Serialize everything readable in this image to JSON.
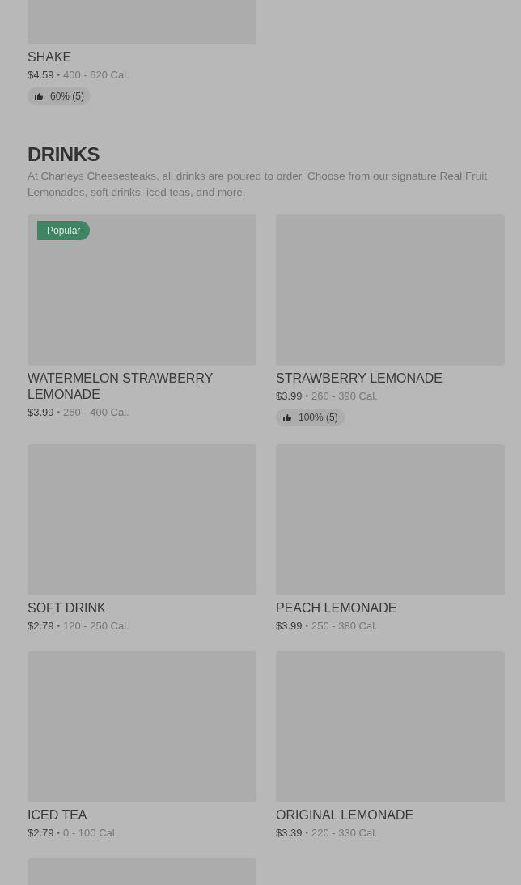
{
  "top_item": {
    "title": "SHAKE",
    "price": "$4.59",
    "separator": "•",
    "calories": "400 - 620 Cal.",
    "rating": "60% (5)"
  },
  "section": {
    "title": "DRINKS",
    "description": "At Charleys Cheesesteaks, all drinks are poured to order. Choose from our signature Real Fruit Lemonades, soft drinks, iced teas, and more.",
    "items": [
      {
        "title": "WATERMELON STRAWBERRY LEMONADE",
        "price": "$3.99",
        "separator": "•",
        "calories": "260 - 400 Cal.",
        "badge": "Popular"
      },
      {
        "title": "STRAWBERRY LEMONADE",
        "price": "$3.99",
        "separator": "•",
        "calories": "260 - 390 Cal.",
        "rating": "100% (5)"
      },
      {
        "title": "SOFT DRINK",
        "price": "$2.79",
        "separator": "•",
        "calories": "120 - 250 Cal."
      },
      {
        "title": "PEACH LEMONADE",
        "price": "$3.99",
        "separator": "•",
        "calories": "250 - 380 Cal."
      },
      {
        "title": "ICED TEA",
        "price": "$2.79",
        "separator": "•",
        "calories": "0 - 100 Cal."
      },
      {
        "title": "ORIGINAL LEMONADE",
        "price": "$3.39",
        "separator": "•",
        "calories": "220 - 330 Cal."
      }
    ]
  }
}
